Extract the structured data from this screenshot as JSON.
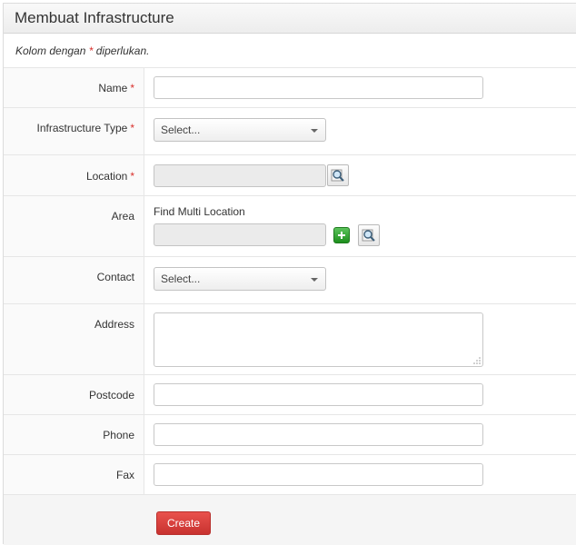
{
  "header": {
    "title": "Membuat Infrastructure"
  },
  "note": {
    "prefix": "Kolom dengan",
    "asterisk": "*",
    "suffix": "diperlukan."
  },
  "form": {
    "name": {
      "label": "Name",
      "required": "*",
      "value": ""
    },
    "infrastructure_type": {
      "label": "Infrastructure Type",
      "required": "*",
      "selected": "Select..."
    },
    "location": {
      "label": "Location",
      "required": "*",
      "value": ""
    },
    "area": {
      "label": "Area",
      "caption": "Find Multi Location",
      "value": ""
    },
    "contact": {
      "label": "Contact",
      "selected": "Select..."
    },
    "address": {
      "label": "Address",
      "value": ""
    },
    "postcode": {
      "label": "Postcode",
      "value": ""
    },
    "phone": {
      "label": "Phone",
      "value": ""
    },
    "fax": {
      "label": "Fax",
      "value": ""
    }
  },
  "actions": {
    "create_label": "Create"
  },
  "icons": {
    "search": "magnifier-icon",
    "add": "plus-icon",
    "dropdown": "caret-down-icon"
  },
  "colors": {
    "required": "#d9302c",
    "create_button": "#d9413d",
    "add_button": "#2e9e2e"
  }
}
